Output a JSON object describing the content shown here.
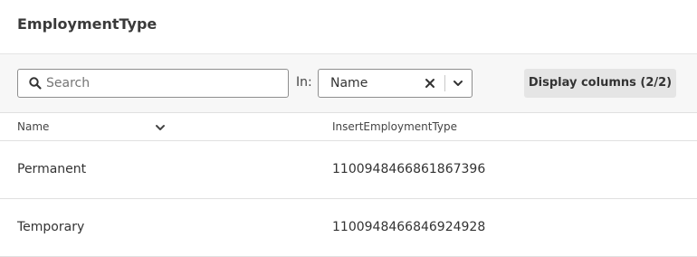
{
  "header": {
    "title": "EmploymentType"
  },
  "toolbar": {
    "search_placeholder": "Search",
    "search_value": "",
    "in_label": "In:",
    "filter_field": "Name",
    "display_columns_label": "Display columns (2/2)"
  },
  "columns": [
    "Name",
    "InsertEmploymentType"
  ],
  "rows": [
    {
      "name": "Permanent",
      "insert_id": "1100948466861867396"
    },
    {
      "name": "Temporary",
      "insert_id": "1100948466846924928"
    }
  ],
  "icons": {
    "search": "search-icon",
    "clear": "close-icon",
    "dropdown": "chevron-down-icon",
    "column_sort": "chevron-down-icon"
  },
  "colors": {
    "toolbar_bg": "#f7f7f7",
    "button_bg": "#e5e5e5",
    "text": "#333333"
  }
}
